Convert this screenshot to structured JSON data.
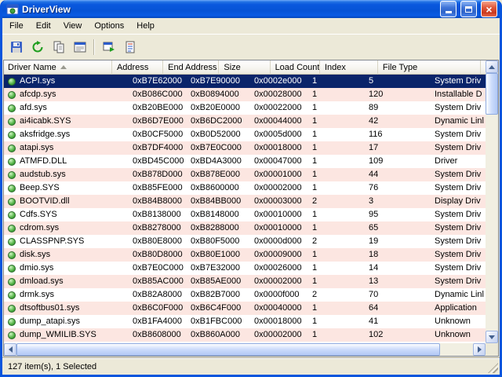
{
  "window": {
    "title": "DriverView"
  },
  "titlebar": {
    "close_glyph": "×"
  },
  "menu": {
    "items": [
      "File",
      "Edit",
      "View",
      "Options",
      "Help"
    ]
  },
  "toolbar": {
    "icons": [
      "save-icon",
      "refresh-icon",
      "copy-icon",
      "properties-icon",
      "run-icon",
      "report-icon"
    ]
  },
  "table": {
    "sort_column": "Driver Name",
    "sort_direction": "asc",
    "columns": [
      {
        "label": "Driver Name",
        "key": "name"
      },
      {
        "label": "Address",
        "key": "address"
      },
      {
        "label": "End Address",
        "key": "end_address"
      },
      {
        "label": "Size",
        "key": "size"
      },
      {
        "label": "Load Count",
        "key": "load_count"
      },
      {
        "label": "Index",
        "key": "index"
      },
      {
        "label": "File Type",
        "key": "file_type"
      }
    ],
    "rows": [
      {
        "name": "ACPI.sys",
        "address": "0xB7E62000",
        "end_address": "0xB7E90000",
        "size": "0x0002e000",
        "load_count": "1",
        "index": "5",
        "file_type": "System Driv",
        "selected": true
      },
      {
        "name": "afcdp.sys",
        "address": "0xB086C000",
        "end_address": "0xB0894000",
        "size": "0x00028000",
        "load_count": "1",
        "index": "120",
        "file_type": "Installable D"
      },
      {
        "name": "afd.sys",
        "address": "0xB20BE000",
        "end_address": "0xB20E0000",
        "size": "0x00022000",
        "load_count": "1",
        "index": "89",
        "file_type": "System Driv"
      },
      {
        "name": "ai4icabk.SYS",
        "address": "0xB6D7E000",
        "end_address": "0xB6DC2000",
        "size": "0x00044000",
        "load_count": "1",
        "index": "42",
        "file_type": "Dynamic Linl"
      },
      {
        "name": "aksfridge.sys",
        "address": "0xB0CF5000",
        "end_address": "0xB0D52000",
        "size": "0x0005d000",
        "load_count": "1",
        "index": "116",
        "file_type": "System Driv"
      },
      {
        "name": "atapi.sys",
        "address": "0xB7DF4000",
        "end_address": "0xB7E0C000",
        "size": "0x00018000",
        "load_count": "1",
        "index": "17",
        "file_type": "System Driv"
      },
      {
        "name": "ATMFD.DLL",
        "address": "0xBD45C000",
        "end_address": "0xBD4A3000",
        "size": "0x00047000",
        "load_count": "1",
        "index": "109",
        "file_type": "Driver"
      },
      {
        "name": "audstub.sys",
        "address": "0xB878D000",
        "end_address": "0xB878E000",
        "size": "0x00001000",
        "load_count": "1",
        "index": "44",
        "file_type": "System Driv"
      },
      {
        "name": "Beep.SYS",
        "address": "0xB85FE000",
        "end_address": "0xB8600000",
        "size": "0x00002000",
        "load_count": "1",
        "index": "76",
        "file_type": "System Driv"
      },
      {
        "name": "BOOTVID.dll",
        "address": "0xB84B8000",
        "end_address": "0xB84BB000",
        "size": "0x00003000",
        "load_count": "2",
        "index": "3",
        "file_type": "Display Driv"
      },
      {
        "name": "Cdfs.SYS",
        "address": "0xB8138000",
        "end_address": "0xB8148000",
        "size": "0x00010000",
        "load_count": "1",
        "index": "95",
        "file_type": "System Driv"
      },
      {
        "name": "cdrom.sys",
        "address": "0xB8278000",
        "end_address": "0xB8288000",
        "size": "0x00010000",
        "load_count": "1",
        "index": "65",
        "file_type": "System Driv"
      },
      {
        "name": "CLASSPNP.SYS",
        "address": "0xB80E8000",
        "end_address": "0xB80F5000",
        "size": "0x0000d000",
        "load_count": "2",
        "index": "19",
        "file_type": "System Driv"
      },
      {
        "name": "disk.sys",
        "address": "0xB80D8000",
        "end_address": "0xB80E1000",
        "size": "0x00009000",
        "load_count": "1",
        "index": "18",
        "file_type": "System Driv"
      },
      {
        "name": "dmio.sys",
        "address": "0xB7E0C000",
        "end_address": "0xB7E32000",
        "size": "0x00026000",
        "load_count": "1",
        "index": "14",
        "file_type": "System Driv"
      },
      {
        "name": "dmload.sys",
        "address": "0xB85AC000",
        "end_address": "0xB85AE000",
        "size": "0x00002000",
        "load_count": "1",
        "index": "13",
        "file_type": "System Driv"
      },
      {
        "name": "drmk.sys",
        "address": "0xB82A8000",
        "end_address": "0xB82B7000",
        "size": "0x0000f000",
        "load_count": "2",
        "index": "70",
        "file_type": "Dynamic Linl"
      },
      {
        "name": "dtsoftbus01.sys",
        "address": "0xB6C0F000",
        "end_address": "0xB6C4F000",
        "size": "0x00040000",
        "load_count": "1",
        "index": "64",
        "file_type": "Application"
      },
      {
        "name": "dump_atapi.sys",
        "address": "0xB1FA4000",
        "end_address": "0xB1FBC000",
        "size": "0x00018000",
        "load_count": "1",
        "index": "41",
        "file_type": "Unknown"
      },
      {
        "name": "dump_WMILIB.SYS",
        "address": "0xB8608000",
        "end_address": "0xB860A000",
        "size": "0x00002000",
        "load_count": "1",
        "index": "102",
        "file_type": "Unknown"
      }
    ]
  },
  "statusbar": {
    "text": "127 item(s), 1 Selected"
  },
  "colors": {
    "selected_row": "#0A246A",
    "alt_row": "#FCE6E1",
    "titlebar_top": "#2272E4",
    "titlebar_bottom": "#0345B8",
    "close_button": "#D9492B"
  }
}
